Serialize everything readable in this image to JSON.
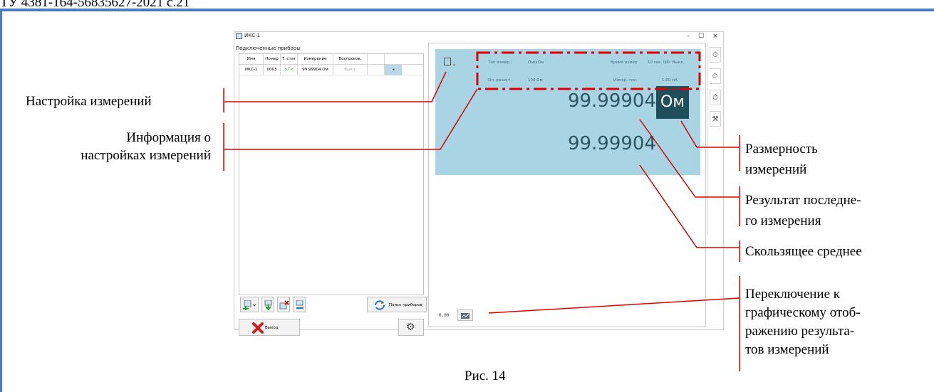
{
  "header": {
    "text": "ТУ 4381-164-56835627-2021 с.21"
  },
  "window": {
    "title": "ИКС-1",
    "min": "–",
    "max": "☐",
    "close": "×"
  },
  "left_panel": {
    "connected_label": "Подключенные приборы",
    "columns": [
      "Имя",
      "Номер",
      "Т. стат",
      "Измерение",
      "Воспроизв."
    ],
    "rows": [
      {
        "name": "ИКС-1",
        "number": "0003",
        "tstat": ">T<",
        "measurement": "99.99904 Ом",
        "reproduce": "Выкл.",
        "arrow": "◂"
      }
    ],
    "search_button": "Поиск приборов",
    "exit_button": "Выход",
    "gear_button": "⚙"
  },
  "measure": {
    "info": {
      "type_label": "Тип измер.:",
      "type_value": "Ом/кОм",
      "time_label": "Время измер.",
      "time_value": "10 сек. ЦФ: Выкл.",
      "ref_label": "Оп. резист.:",
      "ref_value": "100 Ом",
      "current_label": "Измер. ток:",
      "current_value": "1.00 мА"
    },
    "result": "99.99904",
    "unit": "Ом",
    "average": "99.99904",
    "bottom_value": "0.00"
  },
  "annotations": {
    "settings": "Настройка  измерений",
    "info_line1": "Информация о",
    "info_line2": "настройках измерений",
    "unit_line1": "Размерность",
    "unit_line2": "измерений",
    "result_line1": "Результат последне-",
    "result_line2": "го измерения",
    "average": "Скользящее среднее",
    "graph_line1": "Переключение к",
    "graph_line2": "графическому отоб-",
    "graph_line3": "ражению результа-",
    "graph_line4": "тов измерений"
  },
  "caption": "Рис. 14",
  "colors": {
    "accent": "#4a7cc0",
    "measure_bg": "#a9d4e4",
    "unit_bg": "#1f4f5a",
    "annotation": "#e00000"
  }
}
